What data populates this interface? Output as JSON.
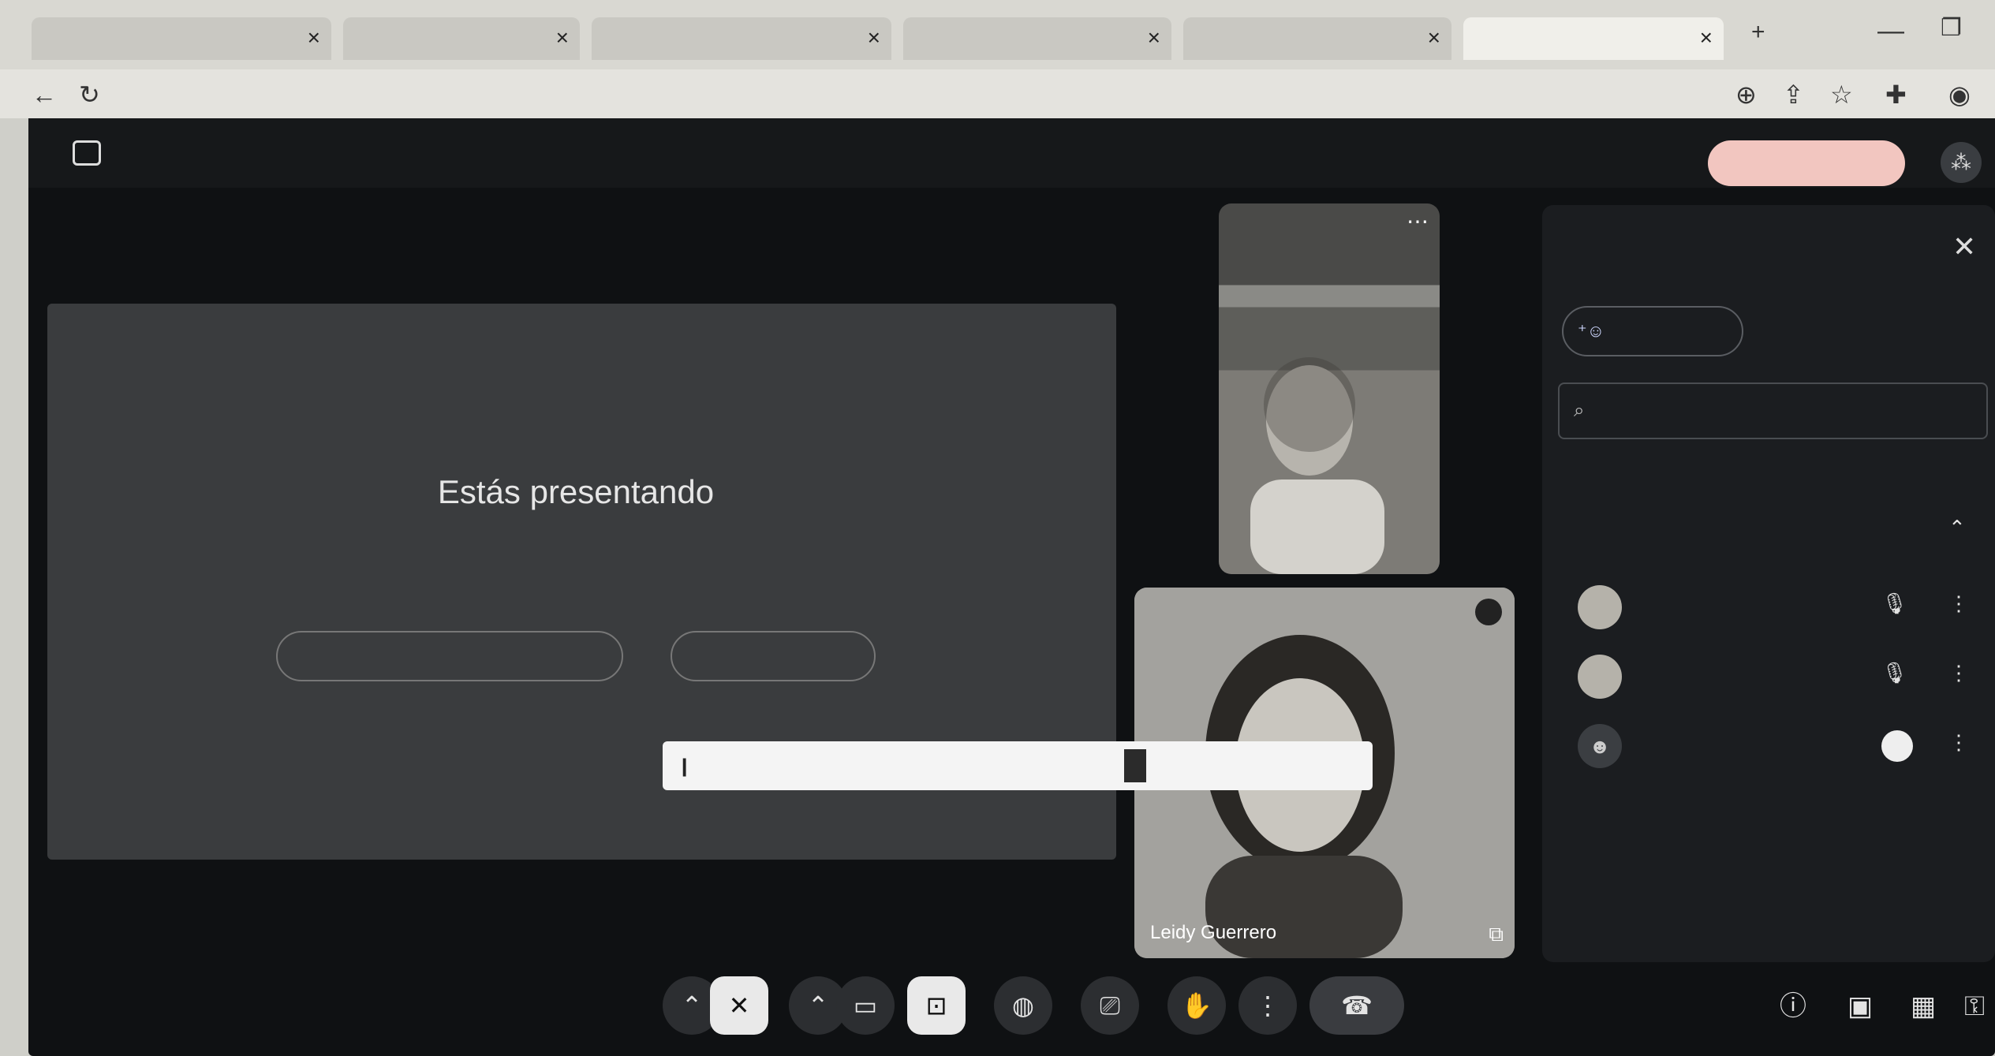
{
  "browser": {
    "tabs": [
      {
        "label": ""
      },
      {
        "label": ""
      },
      {
        "label": ""
      },
      {
        "label": ""
      },
      {
        "label": ""
      },
      {
        "label": ""
      }
    ],
    "url": ""
  },
  "meet": {
    "presenter_label": "",
    "stop_presenting_top": "",
    "presenting_title": "Estás presentando",
    "presenting_body": "",
    "btn_show_everyone": "",
    "btn_stop_presenting": "",
    "notification": {
      "text": "",
      "action_primary": "",
      "action_secondary": ""
    },
    "tile_name": "Leidy Guerrero",
    "tile_badge": "",
    "time_meeting": ""
  },
  "people_panel": {
    "title": "",
    "add_people": "",
    "search_placeholder": "",
    "section_label": "",
    "group_label": "",
    "group_count": "",
    "people": [
      {
        "name": "",
        "sub": ""
      },
      {
        "name": "",
        "sub": ""
      },
      {
        "name": "",
        "sub": ""
      }
    ]
  },
  "colors": {
    "accent_pill": "#f2c6c0",
    "background": "#0f1113",
    "panel": "#1b1d20"
  }
}
